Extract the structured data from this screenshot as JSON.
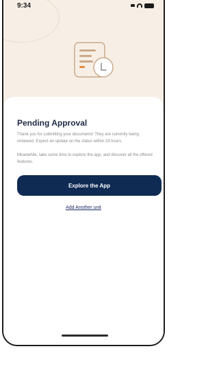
{
  "status_bar": {
    "time": "9:34"
  },
  "screen": {
    "title": "Pending Approval",
    "paragraph_1": "Thank you for submitting your documents! They are currently being reviewed. Expect an update on the status within 24 hours.",
    "paragraph_2": "Meanwhile, take some time to explore the app, and discover all the offered features.",
    "primary_button": "Explore the App",
    "secondary_link": "Add Another unit"
  },
  "colors": {
    "background_top": "#f7efe6",
    "primary": "#0f2b54",
    "title": "#1f2a44",
    "illustration_accent": "#e58a3a"
  },
  "icons": [
    "document-pending-icon"
  ]
}
